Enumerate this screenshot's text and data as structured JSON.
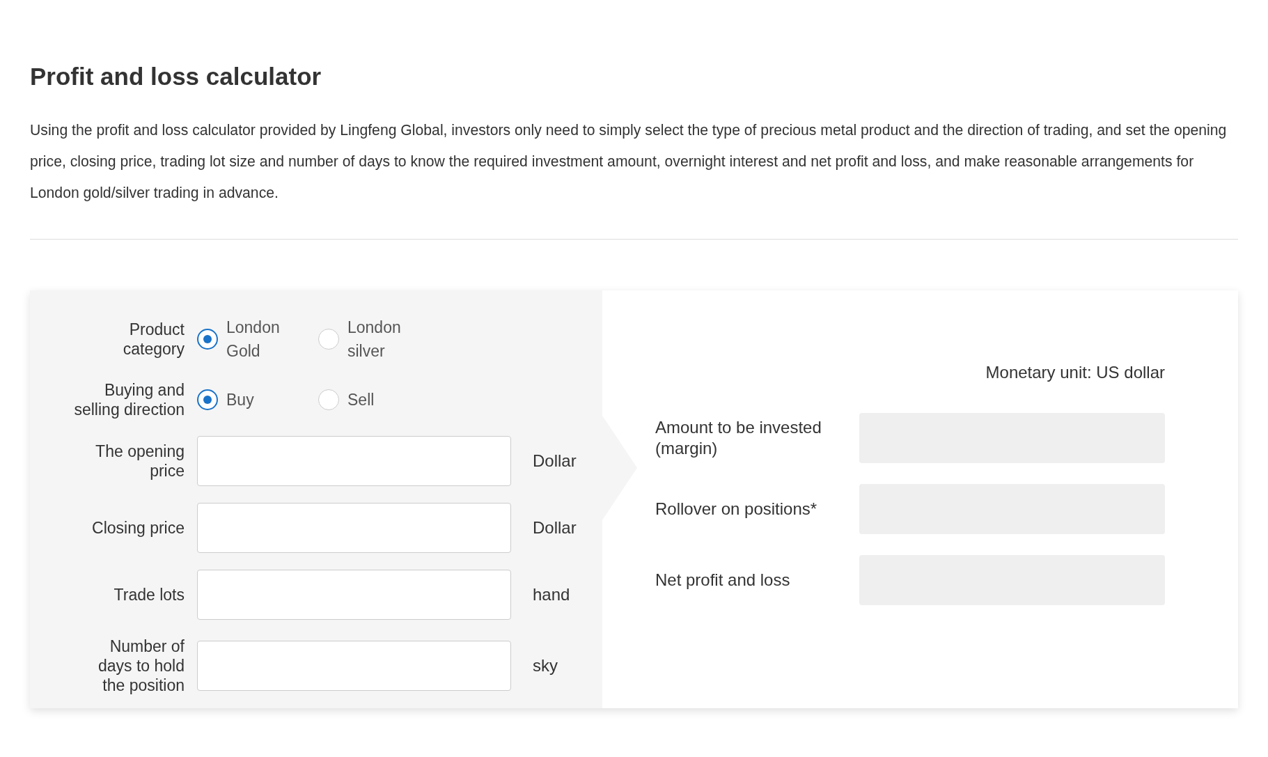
{
  "page": {
    "title": "Profit and loss calculator",
    "intro": "Using the profit and loss calculator provided by Lingfeng Global, investors only need to simply select the type of precious metal product and the direction of trading, and set the opening price, closing price, trading lot size and number of days to know the required investment amount, overnight interest and net profit and loss, and make reasonable arrangements for London gold/silver trading in advance."
  },
  "form": {
    "fields": [
      {
        "kind": "radio",
        "label": "Product category",
        "options": [
          {
            "label": "London Gold",
            "selected": true
          },
          {
            "label": "London silver",
            "selected": false
          }
        ]
      },
      {
        "kind": "radio",
        "label": "Buying and selling direction",
        "options": [
          {
            "label": "Buy",
            "selected": true
          },
          {
            "label": "Sell",
            "selected": false
          }
        ]
      },
      {
        "kind": "input",
        "label": "The opening price",
        "unit": "Dollar"
      },
      {
        "kind": "input",
        "label": "Closing price",
        "unit": "Dollar"
      },
      {
        "kind": "input",
        "label": "Trade lots",
        "unit": "hand"
      },
      {
        "kind": "input",
        "label": "Number of days to hold the position",
        "unit": "sky"
      }
    ]
  },
  "results": {
    "unit_note": "Monetary unit: US dollar",
    "rows": [
      {
        "label": "Amount to be invested (margin)"
      },
      {
        "label": "Rollover on positions*"
      },
      {
        "label": "Net profit and loss"
      }
    ]
  }
}
